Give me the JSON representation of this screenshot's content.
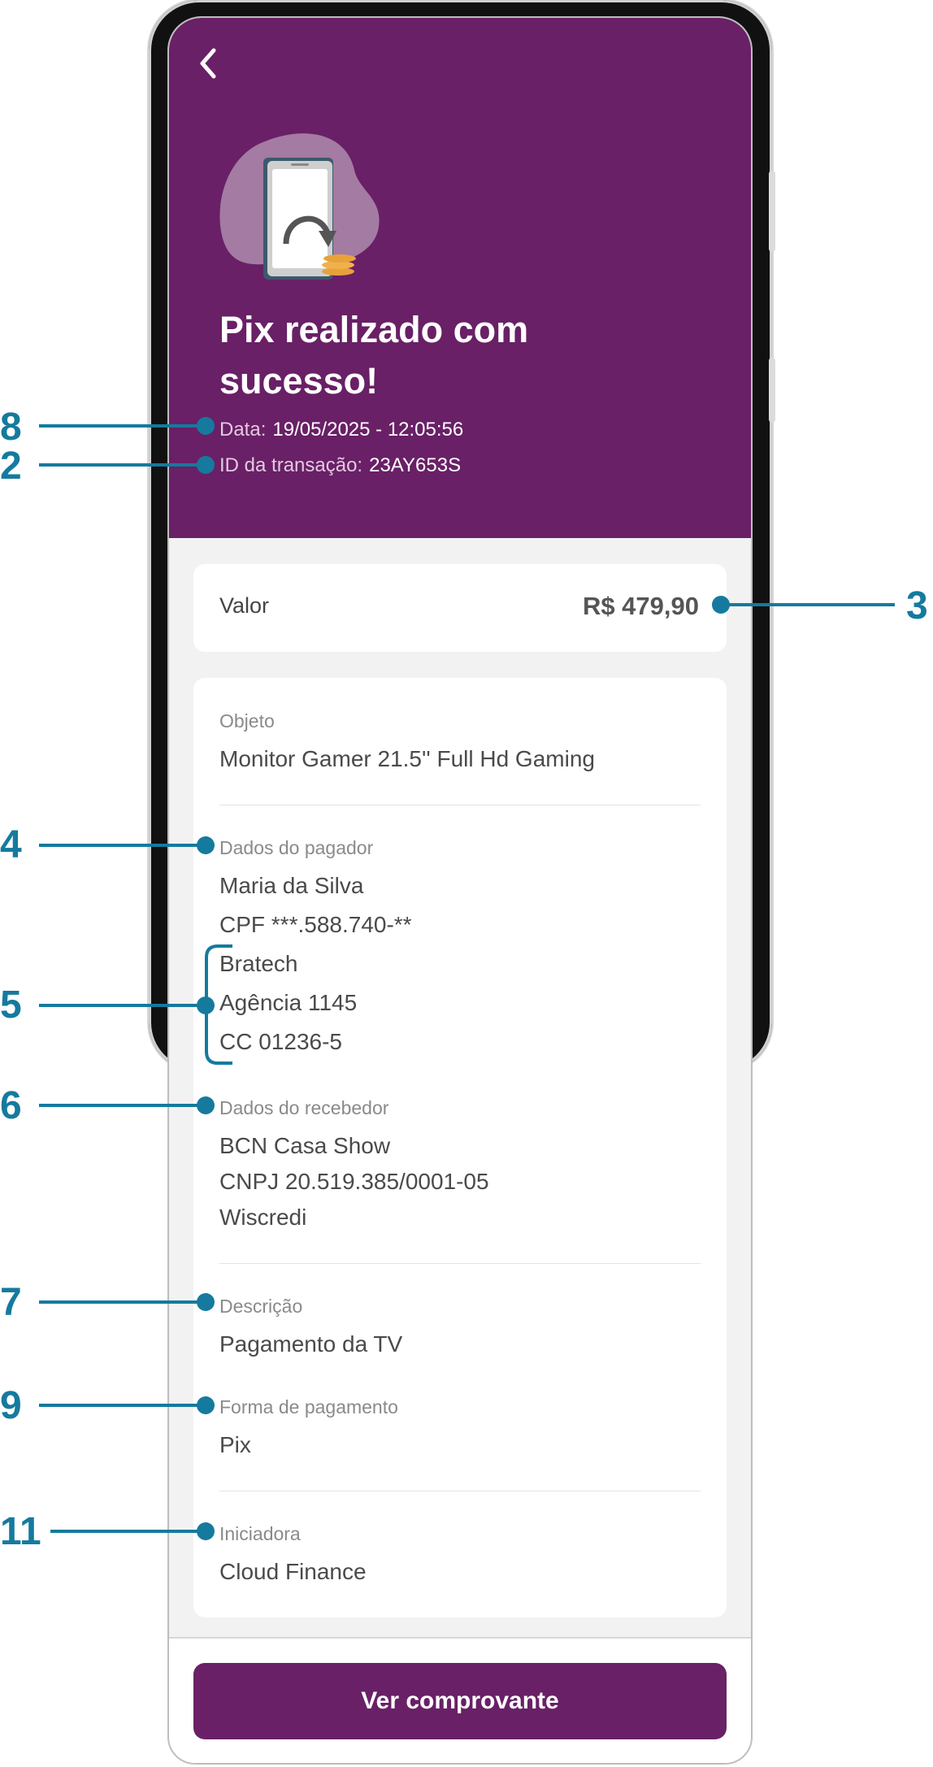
{
  "hero": {
    "title": "Pix realizado com sucesso!",
    "date_label": "Data:",
    "date_value": "19/05/2025 - 12:05:56",
    "id_label": "ID da transação:",
    "id_value": "23AY653S"
  },
  "amount": {
    "label": "Valor",
    "value": "R$ 479,90"
  },
  "details": {
    "object_label": "Objeto",
    "object_value": "Monitor Gamer 21.5'' Full Hd Gaming",
    "payer_label": "Dados do pagador",
    "payer_name": "Maria da Silva",
    "payer_cpf": "CPF ***.588.740-**",
    "payer_bank": "Bratech",
    "payer_agency": "Agência 1145",
    "payer_account": "CC 01236-5",
    "receiver_label": "Dados do recebedor",
    "receiver_name": "BCN Casa Show",
    "receiver_cnpj": "CNPJ 20.519.385/0001-05",
    "receiver_bank": "Wiscredi",
    "description_label": "Descrição",
    "description_value": "Pagamento da TV",
    "payment_method_label": "Forma de pagamento",
    "payment_method_value": "Pix",
    "initiator_label": "Iniciadora",
    "initiator_value": "Cloud Finance"
  },
  "footer": {
    "cta_label": "Ver comprovante"
  },
  "annotations": [
    "8",
    "2",
    "3",
    "4",
    "5",
    "6",
    "7",
    "9",
    "11"
  ],
  "colors": {
    "brand": "#692066",
    "annotation": "#157a9e"
  }
}
